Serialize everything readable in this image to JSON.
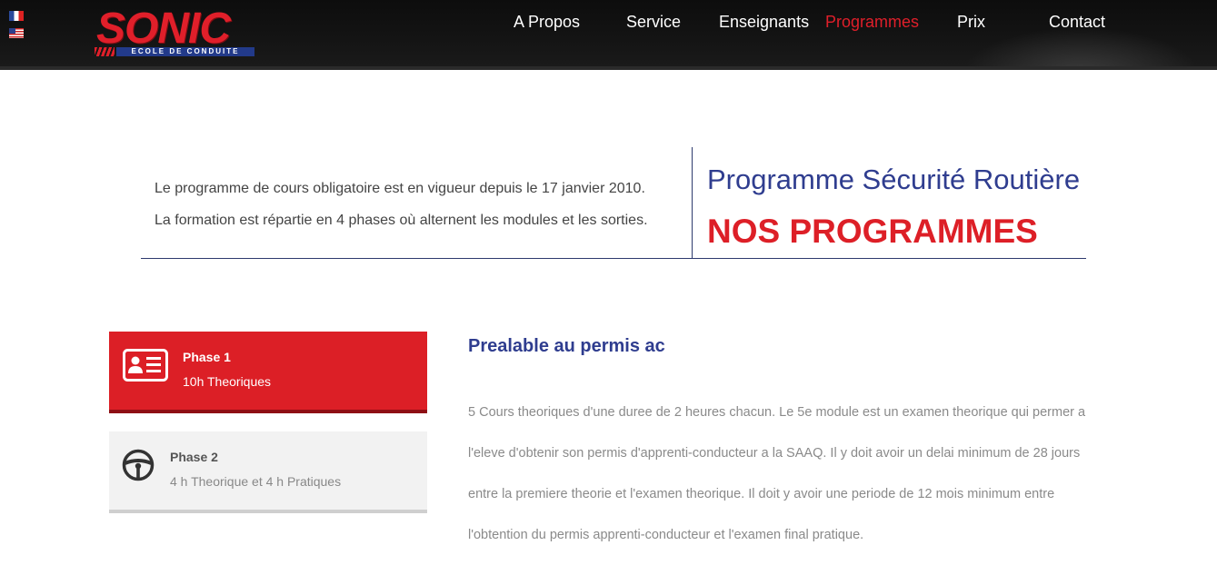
{
  "header": {
    "flags": [
      {
        "name": "french-flag-icon",
        "lang": "fr"
      },
      {
        "name": "us-flag-icon",
        "lang": "en"
      }
    ],
    "logo": {
      "wordmark": "SONIC",
      "tagline": "ECOLE DE CONDUITE"
    },
    "nav": [
      {
        "label": "A Propos",
        "active": false
      },
      {
        "label": "Service",
        "active": false
      },
      {
        "label": "Enseignants",
        "active": false
      },
      {
        "label": "Programmes",
        "active": true
      },
      {
        "label": "Prix",
        "active": false
      },
      {
        "label": "Contact",
        "active": false
      }
    ]
  },
  "intro": {
    "line1": "Le programme de cours obligatoire est en vigueur depuis le 17 janvier 2010.",
    "line2": "La formation est répartie en 4 phases où alternent les modules et les sorties.",
    "subtitle": "Programme Sécurité Routière",
    "title": "NOS PROGRAMMES"
  },
  "phases": [
    {
      "title": "Phase 1",
      "description": "10h Theoriques",
      "icon": "id-card-icon",
      "active": true
    },
    {
      "title": "Phase 2",
      "description": "4 h Theorique et 4 h Pratiques",
      "icon": "steering-wheel-icon",
      "active": false
    }
  ],
  "content": {
    "title": "Prealable au permis ac",
    "lines": [
      "5 Cours theoriques d'une duree de 2 heures chacun. Le 5e module est un examen theorique qui permer a",
      "l'eleve d'obtenir son permis d'apprenti-conducteur a la SAAQ. Il y doit avoir un delai minimum de 28 jours",
      "entre la premiere theorie et l'examen theorique. Il doit y avoir une periode de 12 mois minimum entre",
      "l'obtention du permis apprenti-conducteur et l'examen final pratique."
    ]
  },
  "colors": {
    "brand_red": "#dc1f26",
    "brand_blue": "#2f3d8f",
    "header_bg": "#111111"
  }
}
